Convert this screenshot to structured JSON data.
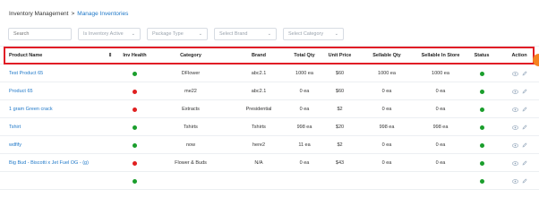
{
  "breadcrumb": {
    "root": "Inventory Management",
    "separator": ">",
    "current": "Manage Inventories"
  },
  "filters": {
    "search_placeholder": "Search",
    "inventory_active": "Is Inventory Active",
    "package_type": "Package Type",
    "brand": "Select Brand",
    "category": "Select Category"
  },
  "colors": {
    "link": "#1f78c8",
    "green_dot": "#1a9e2c",
    "red_dot": "#e02020",
    "highlight_border": "#e11d26",
    "accent_orange": "#f58220"
  },
  "table": {
    "headers": {
      "product_name": "Product Name",
      "inv_health": "Inv Health",
      "category": "Category",
      "brand": "Brand",
      "total_qty": "Total Qty",
      "unit_price": "Unit Price",
      "sellable_qty": "Sellable Qty",
      "sellable_in_store": "Sellable In Store",
      "status": "Status",
      "action": "Action"
    },
    "rows": [
      {
        "name": "Test Product 65",
        "health": "green",
        "category": "DFlower",
        "brand": "abc2.1",
        "total_qty": "1000 ea",
        "unit_price": "$60",
        "sellable_qty": "1000 ea",
        "sellable_in_store": "1000 ea",
        "status": "green"
      },
      {
        "name": "Product 65",
        "health": "red",
        "category": "me22",
        "brand": "abc2.1",
        "total_qty": "0 ea",
        "unit_price": "$60",
        "sellable_qty": "0 ea",
        "sellable_in_store": "0 ea",
        "status": "green"
      },
      {
        "name": "1 gram Green crack",
        "health": "red",
        "category": "Extracts",
        "brand": "Presidential",
        "total_qty": "0 ea",
        "unit_price": "$2",
        "sellable_qty": "0 ea",
        "sellable_in_store": "0 ea",
        "status": "green"
      },
      {
        "name": "Tshirt",
        "health": "green",
        "category": "Tshirts",
        "brand": "Tshirts",
        "total_qty": "998 ea",
        "unit_price": "$20",
        "sellable_qty": "998 ea",
        "sellable_in_store": "998 ea",
        "status": "green"
      },
      {
        "name": "wdfify",
        "health": "green",
        "category": "now",
        "brand": "here2",
        "total_qty": "11 ea",
        "unit_price": "$2",
        "sellable_qty": "0 ea",
        "sellable_in_store": "0 ea",
        "status": "green"
      },
      {
        "name": "Big Bud - Biscotti x Jet Fuel OG - (g)",
        "health": "red",
        "category": "Flower & Buds",
        "brand": "N/A",
        "total_qty": "0 ea",
        "unit_price": "$43",
        "sellable_qty": "0 ea",
        "sellable_in_store": "0 ea",
        "status": "green"
      },
      {
        "name": "",
        "health": "green",
        "category": "",
        "brand": "",
        "total_qty": "",
        "unit_price": "",
        "sellable_qty": "",
        "sellable_in_store": "",
        "status": "green"
      }
    ]
  },
  "icons": {
    "sort": "sort-arrows-icon",
    "view": "eye-icon",
    "edit": "pencil-icon",
    "dropdown": "chevron-down-icon"
  }
}
